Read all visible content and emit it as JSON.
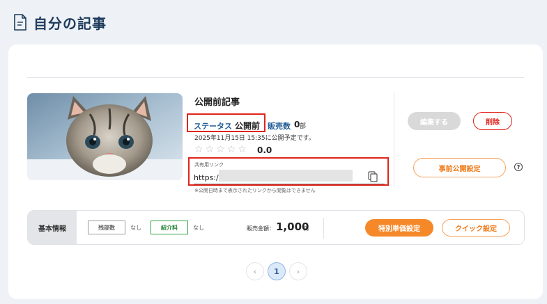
{
  "page": {
    "title": "自分の記事",
    "icon": "document-icon"
  },
  "article": {
    "title": "公開前記事",
    "status_label": "ステータス",
    "status_value": "公開前",
    "sales_label": "販売数",
    "sales_count": "0",
    "sales_unit": "部",
    "schedule_text": "2025年11月15日 15:35に公開予定です。",
    "rating": {
      "value": "0.0",
      "filled_stars": 0,
      "max_stars": 5
    },
    "share_link": {
      "label": "共有用リンク",
      "prefix": "https://",
      "note": "※公開日時まで表示されたリンクから閲覧はできません"
    }
  },
  "actions": {
    "edit": "編集する",
    "delete": "削除",
    "pre_publish_settings": "事前公開設定",
    "help": "?"
  },
  "basic_info": {
    "label": "基本情報",
    "remaining_tag": "残部数",
    "remaining_value": "なし",
    "referral_tag": "紹介料",
    "referral_value": "なし",
    "price_label": "販売金額：",
    "price_value": "1,000",
    "price_unit": "円",
    "special_price_button": "特別単価設定",
    "quick_settings_button": "クイック設定"
  },
  "pagination": {
    "prev": "‹",
    "current": "1",
    "next": "›"
  },
  "colors": {
    "title_navy": "#1d3b5c",
    "link_blue": "#1f5a96",
    "highlight_red": "#e0241b",
    "accent_orange": "#f5892a",
    "referral_green": "#2ea043"
  }
}
